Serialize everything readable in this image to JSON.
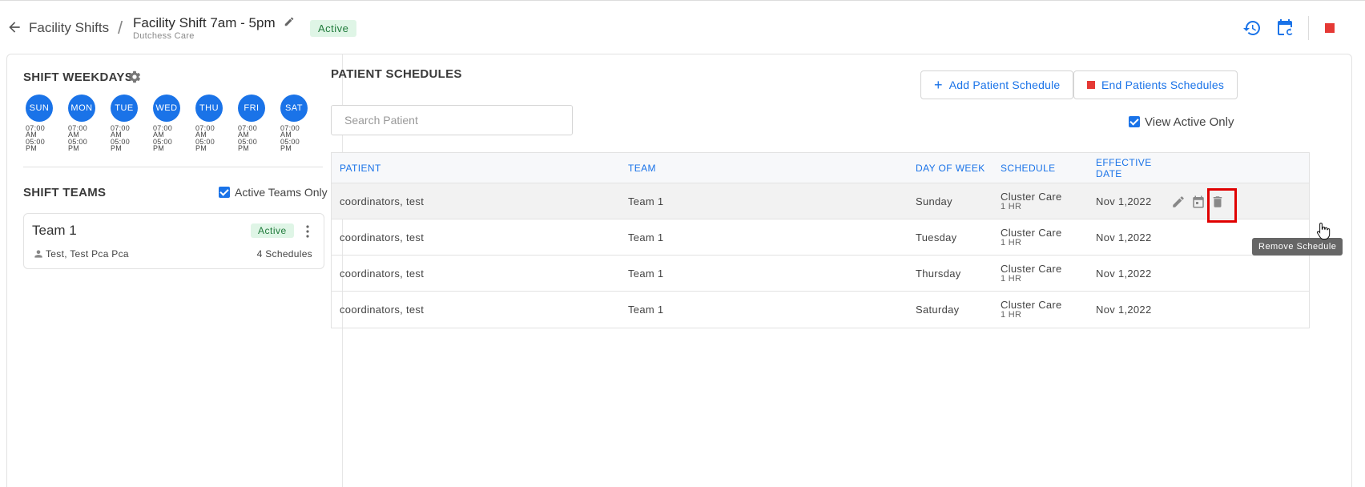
{
  "header": {
    "breadcrumb_parent": "Facility Shifts",
    "separator": "/",
    "title": "Facility Shift 7am - 5pm",
    "subtitle": "Dutchess Care",
    "status": "Active",
    "icons": [
      "back-arrow-icon",
      "pencil-icon",
      "history-icon",
      "calendar-sync-icon",
      "stop-icon"
    ],
    "colors": {
      "accent": "#1a73e8",
      "stop": "#e53935",
      "active_bg": "#dff5e6",
      "active_text": "#1f7a3a"
    }
  },
  "weekdays": {
    "title": "SHIFT WEEKDAYS",
    "days": [
      {
        "label": "SUN",
        "start": "07:00 AM",
        "end": "05:00 PM"
      },
      {
        "label": "MON",
        "start": "07:00 AM",
        "end": "05:00 PM"
      },
      {
        "label": "TUE",
        "start": "07:00 AM",
        "end": "05:00 PM"
      },
      {
        "label": "WED",
        "start": "07:00 AM",
        "end": "05:00 PM"
      },
      {
        "label": "THU",
        "start": "07:00 AM",
        "end": "05:00 PM"
      },
      {
        "label": "FRI",
        "start": "07:00 AM",
        "end": "05:00 PM"
      },
      {
        "label": "SAT",
        "start": "07:00 AM",
        "end": "05:00 PM"
      }
    ]
  },
  "teams": {
    "title": "SHIFT TEAMS",
    "active_only_label": "Active Teams Only",
    "active_only_checked": true,
    "items": [
      {
        "name": "Team 1",
        "status": "Active",
        "members": "Test, Test Pca Pca",
        "schedules": "4 Schedules"
      }
    ]
  },
  "schedules": {
    "title": "PATIENT SCHEDULES",
    "add_button": "Add Patient Schedule",
    "end_button": "End Patients Schedules",
    "search_placeholder": "Search Patient",
    "view_active_label": "View Active Only",
    "view_active_checked": true,
    "columns": [
      "PATIENT",
      "TEAM",
      "DAY OF WEEK",
      "SCHEDULE",
      "EFFECTIVE DATE"
    ],
    "rows": [
      {
        "patient": "coordinators, test",
        "team": "Team 1",
        "day": "Sunday",
        "schedule": "Cluster Care",
        "duration": "1 HR",
        "effective": "Nov 1,2022"
      },
      {
        "patient": "coordinators, test",
        "team": "Team 1",
        "day": "Tuesday",
        "schedule": "Cluster Care",
        "duration": "1 HR",
        "effective": "Nov 1,2022"
      },
      {
        "patient": "coordinators, test",
        "team": "Team 1",
        "day": "Thursday",
        "schedule": "Cluster Care",
        "duration": "1 HR",
        "effective": "Nov 1,2022"
      },
      {
        "patient": "coordinators, test",
        "team": "Team 1",
        "day": "Saturday",
        "schedule": "Cluster Care",
        "duration": "1 HR",
        "effective": "Nov 1,2022"
      }
    ],
    "row_action_icons": [
      "pencil-icon",
      "calendar-icon",
      "trash-icon"
    ],
    "tooltip": "Remove Schedule"
  }
}
